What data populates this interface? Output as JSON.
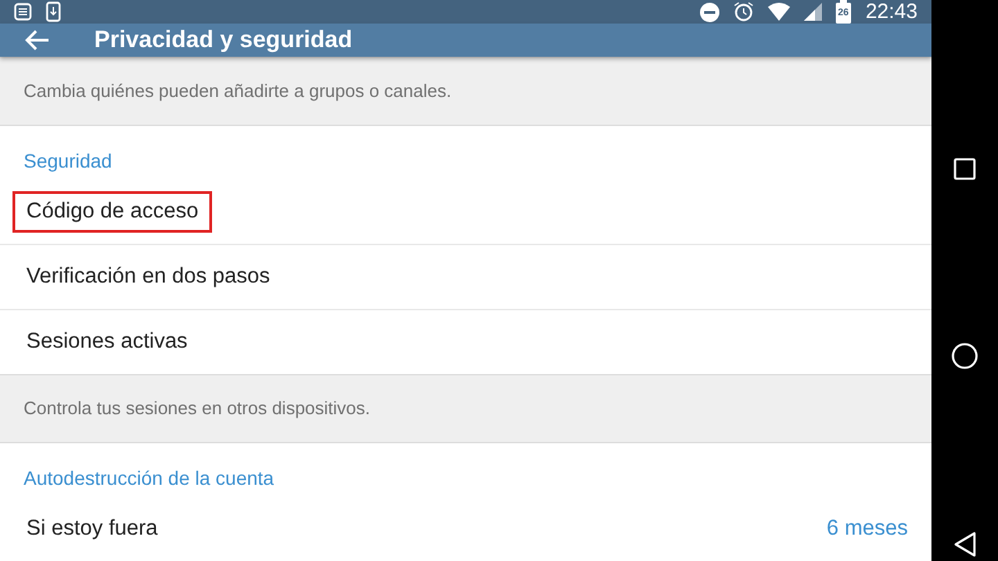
{
  "status_bar": {
    "time": "22:43",
    "battery_level_text": "26"
  },
  "header": {
    "title": "Privacidad y seguridad"
  },
  "sections": [
    {
      "kind": "note",
      "text": "Cambia quiénes pueden añadirte a grupos o canales."
    },
    {
      "kind": "group",
      "title": "Seguridad",
      "items": [
        {
          "label": "Código de acceso",
          "highlighted": true
        },
        {
          "label": "Verificación en dos pasos",
          "highlighted": false
        },
        {
          "label": "Sesiones activas",
          "highlighted": false
        }
      ]
    },
    {
      "kind": "note",
      "text": "Controla tus sesiones en otros dispositivos."
    },
    {
      "kind": "group",
      "title": "Autodestrucción de la cuenta",
      "items": [
        {
          "label": "Si estoy fuera",
          "value": "6 meses",
          "highlighted": false
        }
      ]
    }
  ]
}
